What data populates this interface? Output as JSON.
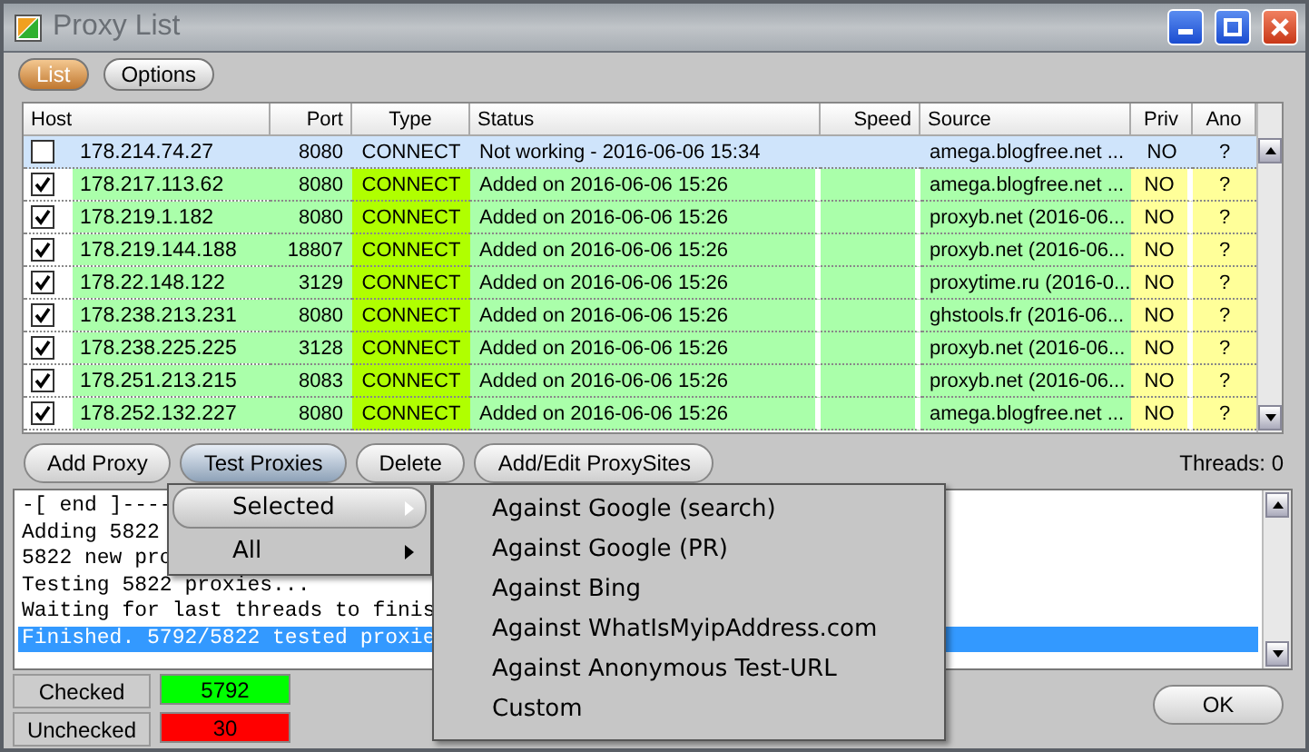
{
  "window": {
    "title": "Proxy List"
  },
  "tabs": [
    {
      "label": "List",
      "selected": true
    },
    {
      "label": "Options",
      "selected": false
    }
  ],
  "table": {
    "columns": [
      "Host",
      "Port",
      "Type",
      "Status",
      "Speed",
      "Source",
      "Priv",
      "Ano"
    ],
    "rows": [
      {
        "checked": false,
        "selected": true,
        "host": "178.214.74.27",
        "port": "8080",
        "type": "CONNECT",
        "status": "Not working - 2016-06-06 15:34",
        "speed": "",
        "source": "amega.blogfree.net ...",
        "priv": "NO",
        "ano": "?"
      },
      {
        "checked": true,
        "selected": false,
        "host": "178.217.113.62",
        "port": "8080",
        "type": "CONNECT",
        "status": "Added on 2016-06-06 15:26",
        "source": "amega.blogfree.net ...",
        "priv": "NO",
        "ano": "?"
      },
      {
        "checked": true,
        "selected": false,
        "host": "178.219.1.182",
        "port": "8080",
        "type": "CONNECT",
        "status": "Added on 2016-06-06 15:26",
        "source": "proxyb.net (2016-06...",
        "priv": "NO",
        "ano": "?"
      },
      {
        "checked": true,
        "selected": false,
        "host": "178.219.144.188",
        "port": "18807",
        "type": "CONNECT",
        "status": "Added on 2016-06-06 15:26",
        "source": "proxyb.net (2016-06...",
        "priv": "NO",
        "ano": "?"
      },
      {
        "checked": true,
        "selected": false,
        "host": "178.22.148.122",
        "port": "3129",
        "type": "CONNECT",
        "status": "Added on 2016-06-06 15:26",
        "source": "proxytime.ru (2016-0...",
        "priv": "NO",
        "ano": "?"
      },
      {
        "checked": true,
        "selected": false,
        "host": "178.238.213.231",
        "port": "8080",
        "type": "CONNECT",
        "status": "Added on 2016-06-06 15:26",
        "source": "ghstools.fr (2016-06...",
        "priv": "NO",
        "ano": "?"
      },
      {
        "checked": true,
        "selected": false,
        "host": "178.238.225.225",
        "port": "3128",
        "type": "CONNECT",
        "status": "Added on 2016-06-06 15:26",
        "source": "proxyb.net (2016-06...",
        "priv": "NO",
        "ano": "?"
      },
      {
        "checked": true,
        "selected": false,
        "host": "178.251.213.215",
        "port": "8083",
        "type": "CONNECT",
        "status": "Added on 2016-06-06 15:26",
        "source": "proxyb.net (2016-06...",
        "priv": "NO",
        "ano": "?"
      },
      {
        "checked": true,
        "selected": false,
        "host": "178.252.132.227",
        "port": "8080",
        "type": "CONNECT",
        "status": "Added on 2016-06-06 15:26",
        "source": "amega.blogfree.net ...",
        "priv": "NO",
        "ano": "?"
      }
    ]
  },
  "buttons": [
    {
      "label": "Add Proxy",
      "pressed": false
    },
    {
      "label": "Test Proxies",
      "pressed": true
    },
    {
      "label": "Delete",
      "pressed": false
    },
    {
      "label": "Add/Edit ProxySites",
      "pressed": false
    }
  ],
  "threads": "Threads: 0",
  "log": [
    {
      "text": "-[ end ]----",
      "selected": false
    },
    {
      "text": "Adding 5822",
      "selected": false
    },
    {
      "text": "5822 new pro",
      "selected": false
    },
    {
      "text": "Testing 5822 proxies...",
      "selected": false
    },
    {
      "text": "Waiting for last threads to finis",
      "selected": false
    },
    {
      "text": "Finished. 5792/5822 tested proxie",
      "selected": true
    }
  ],
  "menu": [
    {
      "label": "Selected",
      "selected": true,
      "submenu": true
    },
    {
      "label": "All",
      "selected": false,
      "submenu": true
    }
  ],
  "submenu": [
    "Against Google (search)",
    "Against Google (PR)",
    "Against Bing",
    "Against WhatIsMyipAddress.com",
    "Against Anonymous Test-URL",
    "Custom"
  ],
  "counters": [
    {
      "label": "Checked",
      "value": "5792",
      "color": "#00ff00"
    },
    {
      "label": "Unchecked",
      "value": "30",
      "color": "#ff0000"
    }
  ],
  "ok_button": "OK"
}
